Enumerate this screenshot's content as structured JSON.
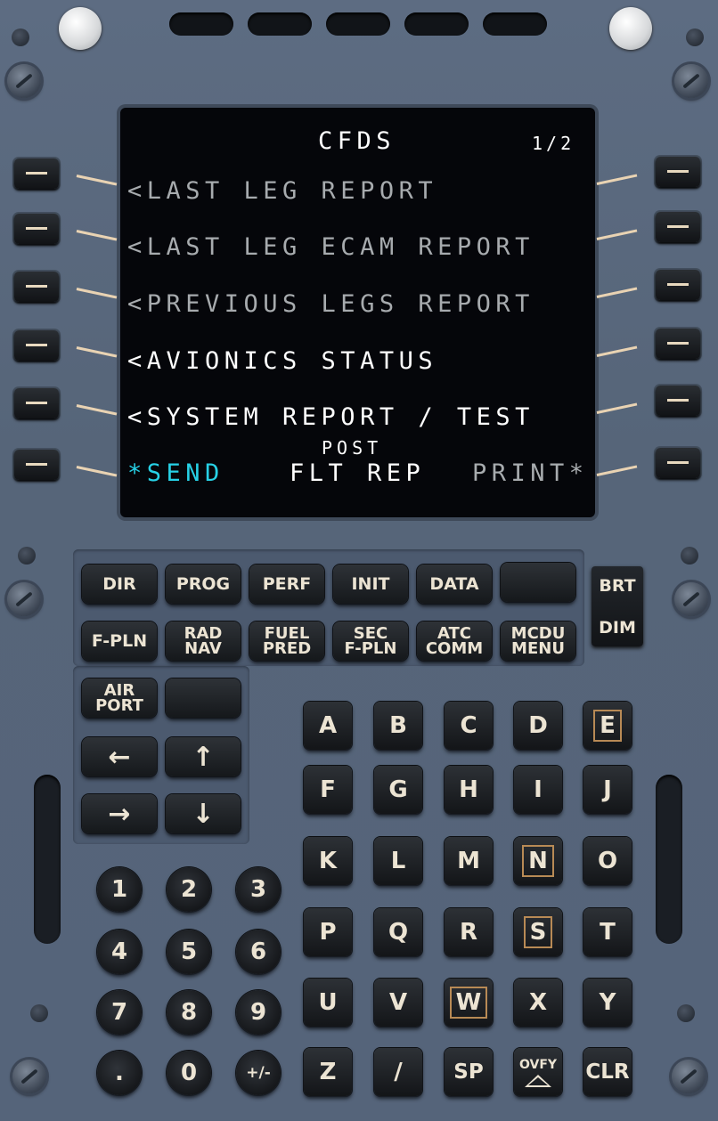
{
  "screen": {
    "title": "CFDS",
    "page": "1/2",
    "lines": [
      {
        "text": "<LAST LEG REPORT",
        "style": "grey"
      },
      {
        "text": "<LAST LEG ECAM REPORT",
        "style": "grey"
      },
      {
        "text": "<PREVIOUS LEGS REPORT",
        "style": "grey"
      },
      {
        "text": "<AVIONICS STATUS",
        "style": "white"
      },
      {
        "text": "<SYSTEM REPORT / TEST",
        "style": "white"
      }
    ],
    "bottom": {
      "send": "*SEND",
      "center_top": "POST",
      "center": "FLT REP",
      "print": "PRINT*"
    }
  },
  "function_keys": {
    "row1": [
      "DIR",
      "PROG",
      "PERF",
      "INIT",
      "DATA",
      ""
    ],
    "row2": [
      "F-PLN",
      "RAD\nNAV",
      "FUEL\nPRED",
      "SEC\nF-PLN",
      "ATC\nCOMM",
      "MCDU\nMENU"
    ],
    "airport": "AIR\nPORT",
    "blank": ""
  },
  "brightness": {
    "brt": "BRT",
    "dim": "DIM"
  },
  "arrows": {
    "left": "←",
    "up": "↑",
    "right": "→",
    "down": "↓"
  },
  "alpha_keys": [
    "A",
    "B",
    "C",
    "D",
    "E",
    "F",
    "G",
    "H",
    "I",
    "J",
    "K",
    "L",
    "M",
    "N",
    "O",
    "P",
    "Q",
    "R",
    "S",
    "T",
    "U",
    "V",
    "W",
    "X",
    "Y",
    "Z",
    "/",
    "SP",
    "OVFY",
    "CLR"
  ],
  "numeric_keys": [
    "1",
    "2",
    "3",
    "4",
    "5",
    "6",
    "7",
    "8",
    "9",
    ".",
    "0",
    "+/-"
  ]
}
